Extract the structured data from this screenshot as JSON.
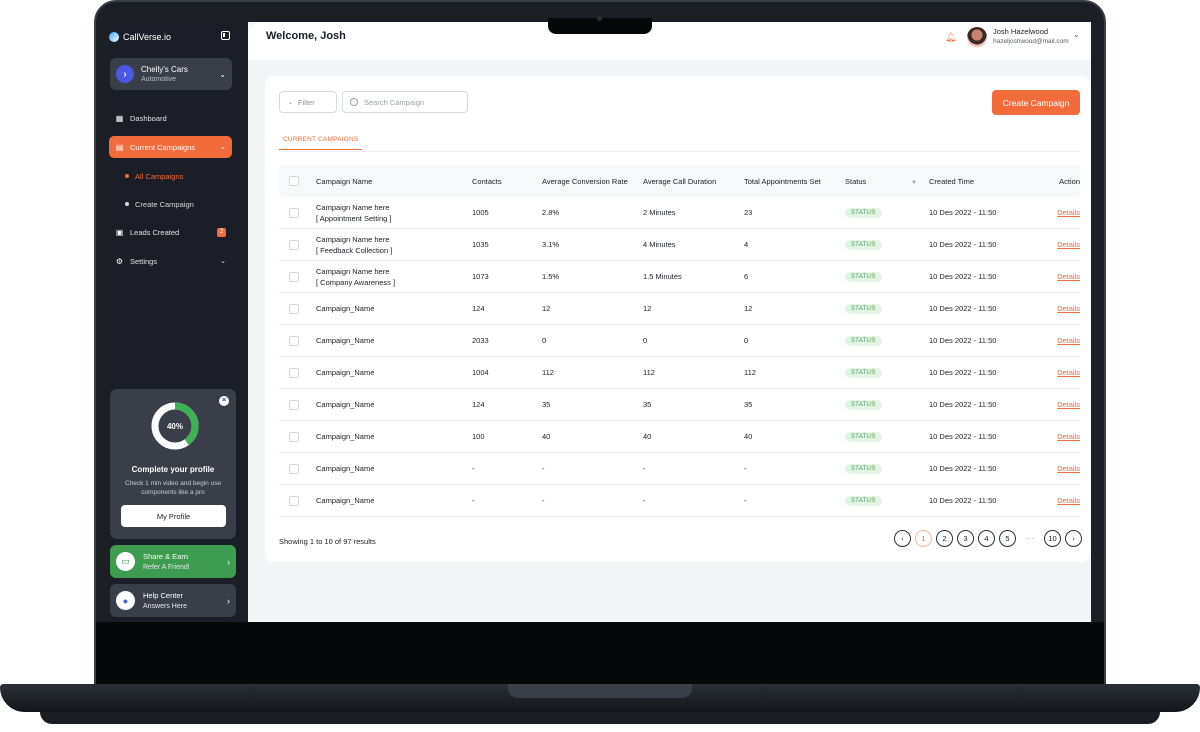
{
  "app": {
    "brand": "CallVerse.io"
  },
  "workspace": {
    "name": "Chelly's Cars",
    "category": "Automotive"
  },
  "sidebar": {
    "items": [
      {
        "label": "Dashboard"
      },
      {
        "label": "Current Campaigns"
      },
      {
        "label": "Leads Created",
        "badge": "2"
      },
      {
        "label": "Settings"
      }
    ],
    "subitems": [
      {
        "label": "All Campaigns"
      },
      {
        "label": "Create Campaign"
      }
    ]
  },
  "profile_card": {
    "progress_percent": 40,
    "progress_label": "40%",
    "title": "Complete your profile",
    "description": "Check 1 min video and begin use components like a pro",
    "button_label": "My Profile"
  },
  "promos": {
    "share": {
      "title": "Share & Earn",
      "subtitle": "Refer A Friend!"
    },
    "help": {
      "title": "Help Center",
      "subtitle": "Answers Here"
    }
  },
  "header": {
    "welcome": "Welcome, Josh",
    "user_name": "Josh Hazelwood",
    "user_email": "hazeljoshwood@mail.com"
  },
  "toolbar": {
    "filter_label": "Filter",
    "search_placeholder": "Search Campaign",
    "create_label": "Create Campaign"
  },
  "tab": {
    "label": "CURRENT CAMPAIGNS"
  },
  "table": {
    "columns": [
      "Campaign Name",
      "Contacts",
      "Average Conversion Rate",
      "Average Call Duration",
      "Total Appointments Set",
      "Status",
      "Created Time",
      "Action"
    ],
    "rows": [
      {
        "name": "Campaign Name here",
        "subname": "[ Appointment Setting ]",
        "contacts": "1005",
        "conversion": "2.8%",
        "duration": "2 Minutes",
        "appointments": "23",
        "status": "STATUS",
        "created": "10 Des 2022 - 11:50",
        "action": "Details"
      },
      {
        "name": "Campaign Name here",
        "subname": "[ Feedback Collection ]",
        "contacts": "1035",
        "conversion": "3.1%",
        "duration": "4 Minutes",
        "appointments": "4",
        "status": "STATUS",
        "created": "10 Des 2022 - 11:50",
        "action": "Details"
      },
      {
        "name": "Campaign Name here",
        "subname": "[ Company Awareness ]",
        "contacts": "1073",
        "conversion": "1.5%",
        "duration": "1.5 Minutes",
        "appointments": "6",
        "status": "STATUS",
        "created": "10 Des 2022 - 11:50",
        "action": "Details"
      },
      {
        "name": "Campaign_Name",
        "subname": "",
        "contacts": "124",
        "conversion": "12",
        "duration": "12",
        "appointments": "12",
        "status": "STATUS",
        "created": "10 Des 2022 - 11:50",
        "action": "Details"
      },
      {
        "name": "Campaign_Name",
        "subname": "",
        "contacts": "2033",
        "conversion": "0",
        "duration": "0",
        "appointments": "0",
        "status": "STATUS",
        "created": "10 Des 2022 - 11:50",
        "action": "Details"
      },
      {
        "name": "Campaign_Name",
        "subname": "",
        "contacts": "1004",
        "conversion": "112",
        "duration": "112",
        "appointments": "112",
        "status": "STATUS",
        "created": "10 Des 2022 - 11:50",
        "action": "Details"
      },
      {
        "name": "Campaign_Name",
        "subname": "",
        "contacts": "124",
        "conversion": "35",
        "duration": "35",
        "appointments": "35",
        "status": "STATUS",
        "created": "10 Des 2022 - 11:50",
        "action": "Details"
      },
      {
        "name": "Campaign_Name",
        "subname": "",
        "contacts": "100",
        "conversion": "40",
        "duration": "40",
        "appointments": "40",
        "status": "STATUS",
        "created": "10 Des 2022 - 11:50",
        "action": "Details"
      },
      {
        "name": "Campaign_Name",
        "subname": "",
        "contacts": "-",
        "conversion": "-",
        "duration": "-",
        "appointments": "-",
        "status": "STATUS",
        "created": "10 Des 2022 - 11:50",
        "action": "Details"
      },
      {
        "name": "Campaign_Name",
        "subname": "",
        "contacts": "-",
        "conversion": "-",
        "duration": "-",
        "appointments": "-",
        "status": "STATUS",
        "created": "10 Des 2022 - 11:50",
        "action": "Details"
      }
    ]
  },
  "pagination": {
    "summary": "Showing 1 to 10 of 97 results",
    "pages": [
      "1",
      "2",
      "3",
      "4",
      "5"
    ],
    "ellipsis": "···",
    "last": "10",
    "current": "1"
  },
  "colors": {
    "accent": "#f26b3a",
    "sidebar_bg": "#1b1e26",
    "success": "#3d9c4f"
  },
  "icons": {
    "brand": "callverse-logo-icon",
    "collapse": "sidebar-collapse-icon",
    "dashboard": "grid-icon",
    "campaigns": "campaign-icon",
    "leads": "leads-icon",
    "settings": "gear-icon",
    "notification": "bell-icon",
    "search": "search-icon"
  }
}
